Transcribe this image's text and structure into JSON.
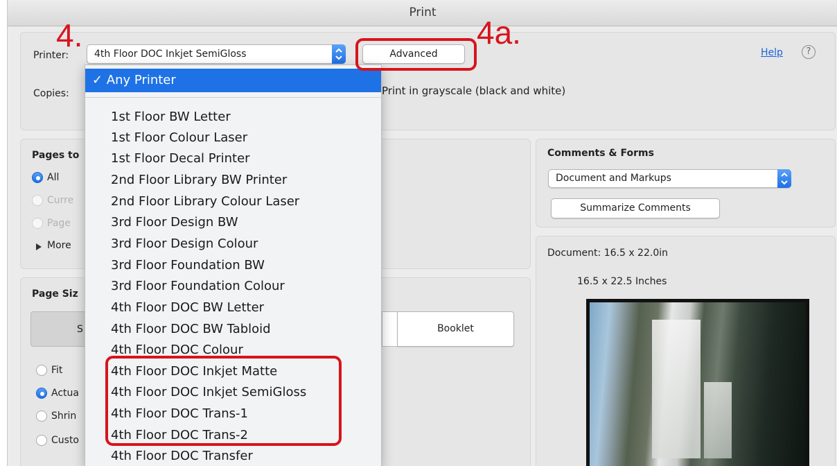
{
  "window": {
    "title": "Print"
  },
  "printer": {
    "label": "Printer:",
    "selected": "4th Floor DOC Inkjet SemiGloss",
    "advanced_button": "Advanced",
    "help_link": "Help",
    "help_icon": "?"
  },
  "copies": {
    "label": "Copies:",
    "grayscale_label": "Print in grayscale (black and white)"
  },
  "pages": {
    "title": "Pages to",
    "options": [
      "All",
      "Curre",
      "Page"
    ],
    "more_label": "More"
  },
  "page_size": {
    "title": "Page Siz",
    "tab_left": "S",
    "booklet_button": "Booklet",
    "options": [
      "Fit",
      "Actua",
      "Shrin",
      "Custo"
    ]
  },
  "comments_forms": {
    "title": "Comments & Forms",
    "selected": "Document and Markups",
    "summarize_button": "Summarize Comments"
  },
  "preview": {
    "document_size": "Document: 16.5 x 22.0in",
    "paper_size": "16.5 x 22.5 Inches"
  },
  "dropdown": {
    "selected": "✓ Any Printer",
    "items": [
      "1st Floor BW Letter",
      "1st Floor Colour Laser",
      "1st Floor Decal Printer",
      "2nd Floor Library BW Printer",
      "2nd Floor Library Colour Laser",
      "3rd Floor Design BW",
      "3rd Floor Design Colour",
      "3rd Floor Foundation BW",
      "3rd Floor Foundation Colour",
      "4th Floor DOC BW Letter",
      "4th Floor DOC BW Tabloid",
      "4th Floor DOC Colour",
      "4th Floor DOC Inkjet Matte",
      "4th Floor DOC Inkjet SemiGloss",
      "4th Floor DOC Trans-1",
      "4th Floor DOC Trans-2",
      "4th Floor DOC Transfer"
    ]
  },
  "annotations": {
    "step": "4.",
    "step_a": "4a.",
    "color": "#d7141d"
  },
  "colors": {
    "accent": "#1e72e6",
    "window_bg": "#ececec"
  }
}
